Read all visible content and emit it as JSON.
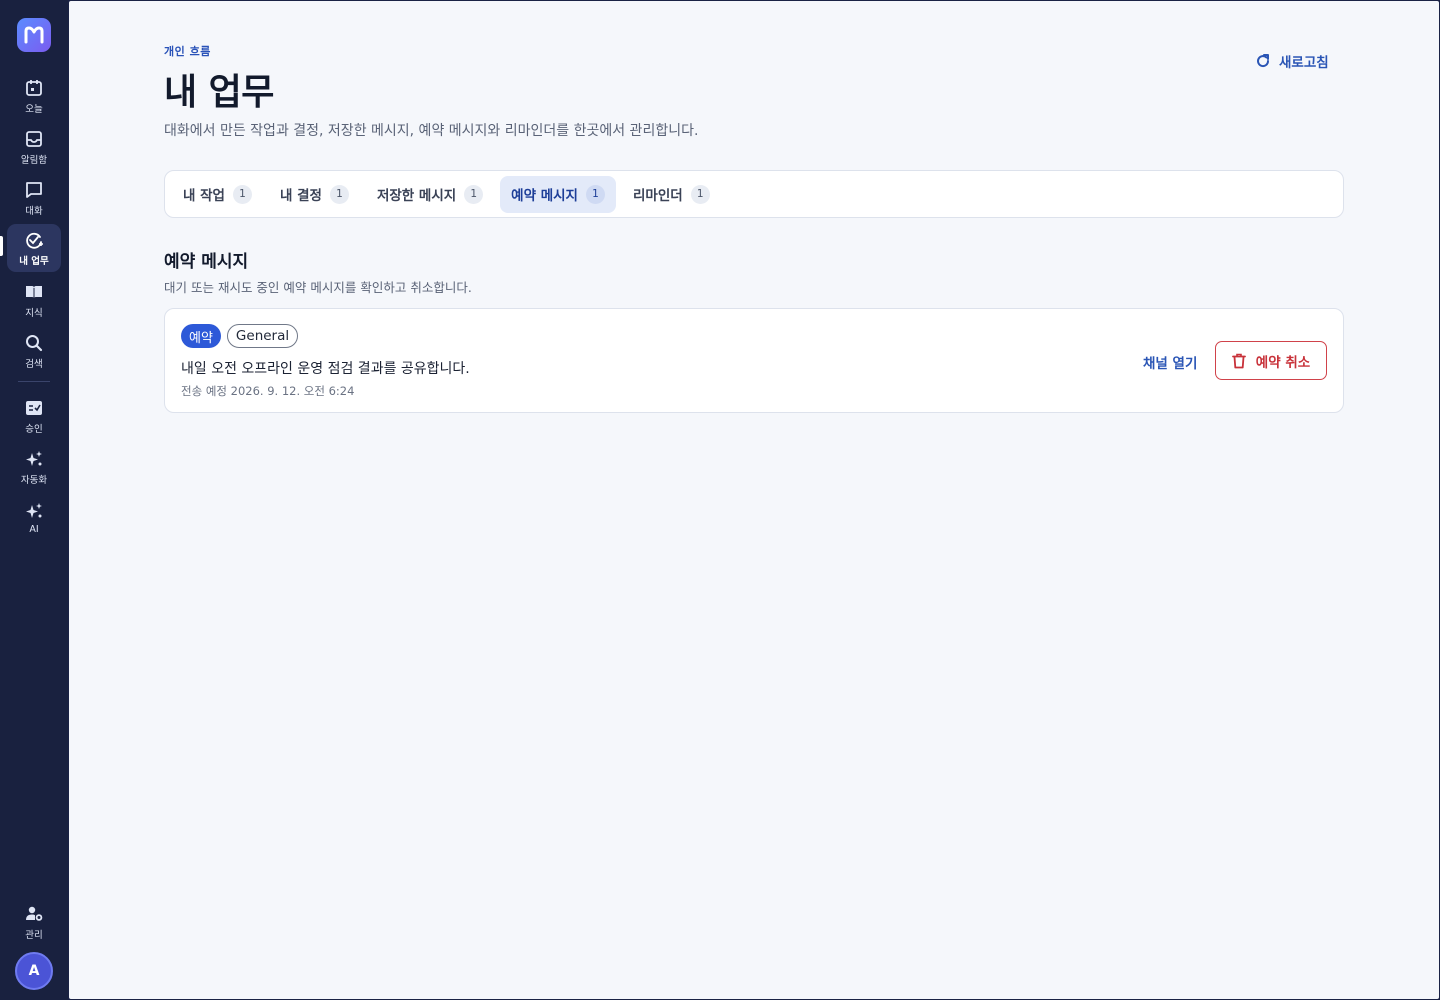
{
  "sidebar": {
    "items": [
      {
        "label": "오늘",
        "icon": "calendar-icon"
      },
      {
        "label": "알림함",
        "icon": "inbox-icon"
      },
      {
        "label": "대화",
        "icon": "chat-icon"
      },
      {
        "label": "내 업무",
        "icon": "task-check-icon",
        "active": true
      },
      {
        "label": "지식",
        "icon": "book-icon"
      },
      {
        "label": "검색",
        "icon": "search-icon"
      },
      {
        "label": "승인",
        "icon": "approval-icon"
      },
      {
        "label": "자동화",
        "icon": "sparkle-icon"
      },
      {
        "label": "AI",
        "icon": "ai-sparkle-icon"
      }
    ],
    "admin_label": "관리",
    "avatar_initial": "A"
  },
  "header": {
    "eyebrow": "개인 흐름",
    "title": "내 업무",
    "description": "대화에서 만든 작업과 결정, 저장한 메시지, 예약 메시지와 리마인더를 한곳에서 관리합니다.",
    "refresh_label": "새로고침"
  },
  "tabs": [
    {
      "label": "내 작업",
      "count": "1"
    },
    {
      "label": "내 결정",
      "count": "1"
    },
    {
      "label": "저장한 메시지",
      "count": "1"
    },
    {
      "label": "예약 메시지",
      "count": "1",
      "active": true
    },
    {
      "label": "리마인더",
      "count": "1"
    }
  ],
  "section": {
    "title": "예약 메시지",
    "description": "대기 또는 재시도 중인 예약 메시지를 확인하고 취소합니다."
  },
  "scheduled_messages": [
    {
      "status_badge": "예약",
      "channel_badge": "General",
      "text": "내일 오전 오프라인 운영 점검 결과를 공유합니다.",
      "meta": "전송 예정 2026. 9. 12. 오전 6:24",
      "open_channel_label": "채널 열기",
      "cancel_label": "예약 취소"
    }
  ],
  "colors": {
    "sidebar_bg": "#19213f",
    "accent": "#2d59d8",
    "danger": "#c8323a",
    "content_bg": "#f5f7fb"
  }
}
